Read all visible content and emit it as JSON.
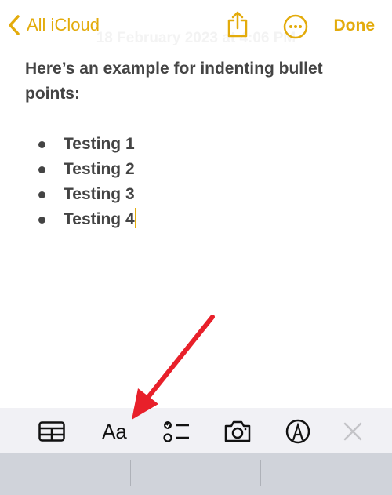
{
  "nav": {
    "back_label": "All iCloud",
    "done_label": "Done",
    "date": "18 February 2023 at 4:06 PM"
  },
  "note": {
    "intro": "Here’s an example for indenting bullet points:",
    "bullets": [
      "Testing 1",
      "Testing 2",
      "Testing 3",
      "Testing 4"
    ]
  },
  "toolbar": {
    "format_label": "Aa",
    "icons": [
      "table-icon",
      "format-icon",
      "checklist-icon",
      "camera-icon",
      "markup-icon",
      "close-icon"
    ]
  },
  "colors": {
    "accent": "#e3ab0b",
    "annotation_arrow": "#e8202a"
  }
}
